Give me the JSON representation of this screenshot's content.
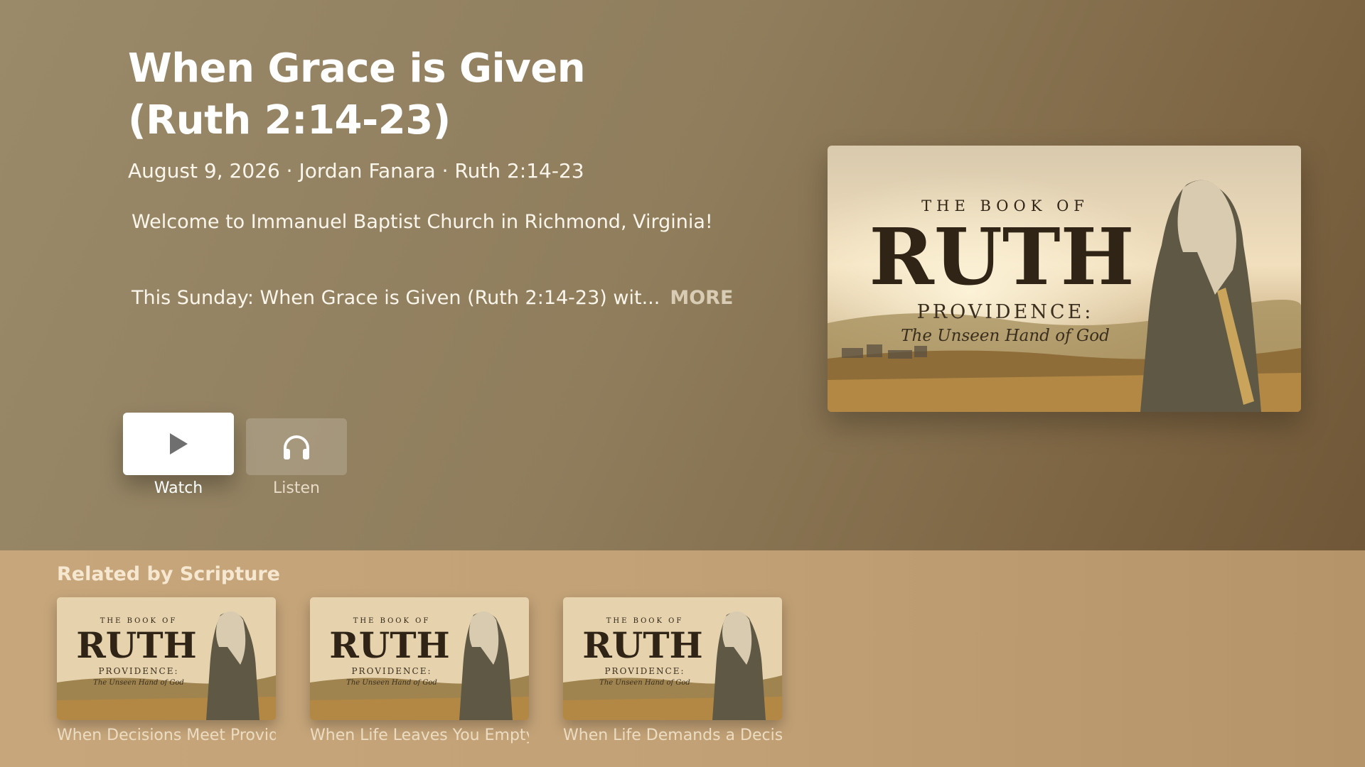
{
  "sermon": {
    "title": "When Grace is Given (Ruth 2:14-23)",
    "meta": "August 9, 2026 · Jordan Fanara · Ruth 2:14-23",
    "description_line1": "Welcome to Immanuel Baptist Church in Richmond, Virginia!",
    "description_line2": "This Sunday: When Grace is Given (Ruth 2:14-23) wit...",
    "more_label": "MORE"
  },
  "artwork": {
    "series_top": "THE BOOK OF",
    "series_name": "RUTH",
    "series_sub": "PROVIDENCE:",
    "series_tagline": "The Unseen Hand of God"
  },
  "actions": {
    "watch_label": "Watch",
    "listen_label": "Listen",
    "watch_icon": "play-icon",
    "listen_icon": "headphones-icon"
  },
  "related": {
    "heading": "Related by Scripture",
    "items": [
      {
        "title": "When Decisions Meet Provide"
      },
      {
        "title": "When Life Leaves You Empty ("
      },
      {
        "title": "When Life Demands a Decisio"
      }
    ]
  },
  "colors": {
    "hero_bg": "#8f7d5c",
    "related_bg": "#c2a176",
    "accent_text": "#f6e8d0"
  }
}
